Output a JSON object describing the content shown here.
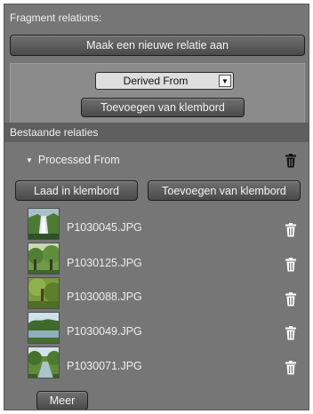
{
  "fragment": {
    "title": "Fragment relations:",
    "new_relation_button": "Maak een nieuwe relatie aan",
    "relation_type": "Derived From",
    "add_from_clipboard_button": "Toevoegen van klembord"
  },
  "existing": {
    "title": "Bestaande relaties",
    "relation_name": "Processed From",
    "load_clipboard_button": "Laad in klembord",
    "add_clipboard_button": "Toevoegen van klembord",
    "items": [
      {
        "name": "P1030045.JPG",
        "icon": "waterfall-photo"
      },
      {
        "name": "P1030125.JPG",
        "icon": "forest-photo"
      },
      {
        "name": "P1030088.JPG",
        "icon": "trees-photo"
      },
      {
        "name": "P1030049.JPG",
        "icon": "lake-photo"
      },
      {
        "name": "P1030071.JPG",
        "icon": "river-photo"
      }
    ],
    "more_button": "Meer"
  },
  "colors": {
    "panel_bg": "#767676",
    "inner_box_bg": "#8b8b8b",
    "group_header_bg": "#5f5f5f",
    "button_bg": "#4a4a4a",
    "text": "#f1f1f1"
  }
}
